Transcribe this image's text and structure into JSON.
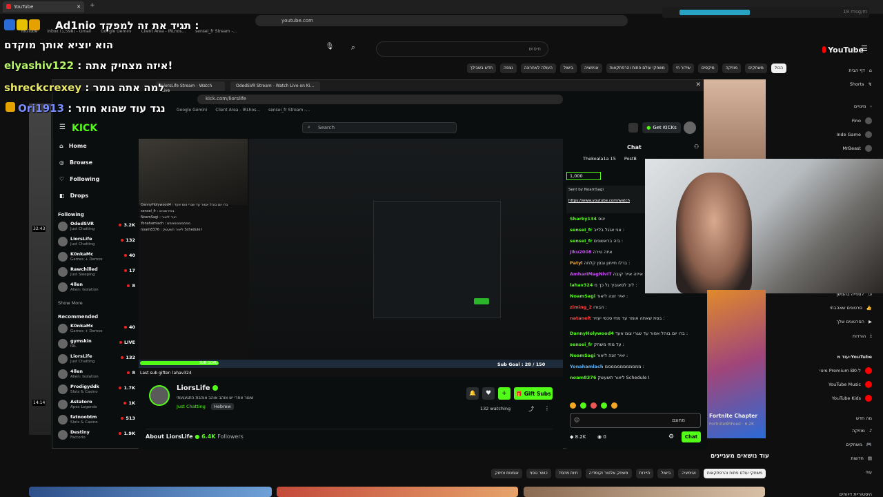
{
  "outer_browser": {
    "tab_title": "YouTube",
    "url": "youtube.com",
    "bookmarks": [
      "YouTube",
      "Inbox (1,598) - Gmail",
      "Google Gemini",
      "Client Area - IRLhos...",
      "sensei_fr Stream -..."
    ],
    "media_label": "18 msg/m"
  },
  "chat_overlay": [
    {
      "user": "Ad1nio",
      "text": "תגיד את זה למפקד :"
    },
    {
      "user": "",
      "text": "הוא יוציא אותך מוקדם"
    },
    {
      "user": "elyashiv122",
      "text": ": איזה מצחיק אתה!"
    },
    {
      "user": "shreckcrexey",
      "text": ": למה אתה גומר"
    },
    {
      "user": "Ori1913",
      "text": ": נגד עוד שהוא חוזר"
    }
  ],
  "youtube": {
    "logo": "YouTube",
    "search_placeholder": "חיפוש",
    "chips": [
      "הכול",
      "משחקים",
      "מוזיקה",
      "מיקסים",
      "שידור חי",
      "משחקי עולם פתוח והרפתקאות",
      "אנימציה",
      "בישול",
      "העולה לאחרונה",
      "נצפה",
      "חדש בשבילך"
    ],
    "sidebar": [
      {
        "label": "דף הבית"
      },
      {
        "label": "Shorts"
      },
      {
        "label": "מינויים"
      },
      {
        "label": "Fino"
      },
      {
        "label": "Inde Game"
      },
      {
        "label": "MrBeast"
      },
      {
        "label": "לצפייה בהמשך"
      },
      {
        "label": "סרטונים שאהבתי"
      },
      {
        "label": "הסרטונים שלך"
      },
      {
        "label": "הורדות"
      },
      {
        "label": "עוד מ-YouTube"
      },
      {
        "label": "מינוי Premium ל-₪0"
      },
      {
        "label": "YouTube Music"
      },
      {
        "label": "YouTube Kids"
      },
      {
        "label": "מה חדש"
      },
      {
        "label": "מוזיקה"
      },
      {
        "label": "משחקים"
      },
      {
        "label": "חדשות"
      },
      {
        "label": "עוד"
      },
      {
        "label": "היסטוריית דיווחים"
      }
    ],
    "video_title": "Fortnite Chapter 6 Season 4 Trailer",
    "video_meta": "FortniteBRFeed · 6.2K",
    "topics_heading": "עוד נושאים מעניינים",
    "bottom_chips": [
      "משחקי עולם פתוח והרפתקאות",
      "אנימציה",
      "בישול",
      "תיירות",
      "משחק אלטור וקומדיה",
      "חיות מחמד",
      "כושר גופני",
      "אומנות וחיזוק"
    ],
    "timestamps": [
      "32:43",
      "14:14"
    ]
  },
  "kick_window": {
    "tabs": [
      "LiorsLife Stream - Watch Live",
      "OdedSVR Stream - Watch Live on Ki..."
    ],
    "url": "kick.com/liorslife",
    "bookmarks": [
      "Google Gemini",
      "Client Area - IRLhos...",
      "sensei_fr Stream -..."
    ],
    "logo": "KICK",
    "search_placeholder": "Search",
    "get_kicks": "Get KICKs",
    "nav": [
      {
        "label": "Home"
      },
      {
        "label": "Browse"
      },
      {
        "label": "Following"
      },
      {
        "label": "Drops"
      }
    ],
    "following_heading": "Following",
    "following": [
      {
        "name": "OdedSVR",
        "category": "Just Chatting",
        "viewers": "3.2K"
      },
      {
        "name": "LiorsLife",
        "category": "Just Chatting",
        "viewers": "132"
      },
      {
        "name": "K0nkaMc",
        "category": "Games + Demos",
        "viewers": "40"
      },
      {
        "name": "Rawchilled",
        "category": "Just Sleeping",
        "viewers": "17"
      },
      {
        "name": "4llen",
        "category": "Alien: Isolation",
        "viewers": "8"
      }
    ],
    "show_more": "Show More",
    "recommended_heading": "Recommended",
    "recommended": [
      {
        "name": "K0nkaMc",
        "category": "Games + Demos",
        "viewers": "40"
      },
      {
        "name": "gymskin",
        "category": "IRL",
        "viewers": "LIVE"
      },
      {
        "name": "LiorsLife",
        "category": "Just Chatting",
        "viewers": "132"
      },
      {
        "name": "4llen",
        "category": "Alien: Isolation",
        "viewers": "8"
      },
      {
        "name": "Prodigyddk",
        "category": "Slots & Casino",
        "viewers": "1.7K"
      },
      {
        "name": "Astatoro",
        "category": "Apex Legends",
        "viewers": "1K"
      },
      {
        "name": "fatnoobtm",
        "category": "Slots & Casino",
        "viewers": "513"
      },
      {
        "name": "Destiny",
        "category": "Factorio",
        "viewers": "1.9K"
      }
    ],
    "stream": {
      "name": "LiorsLife",
      "subtitle": "שיגור אחרי יש אוהב אוהב אוהבת התגעגעתי",
      "category": "Just Chatting",
      "language": "Hebrew",
      "watching": "132 watching",
      "gift_subs": "Gift Subs",
      "about": "About LiorsLife",
      "followers": "6.4K",
      "followers_label": "Followers",
      "last_sub": "Last sub gifter: lahav324",
      "sub_goal": "Sub Goal : 28 / 150",
      "sub_goal_fraction": 0.19,
      "goal_text": "SUB GOAL:"
    },
    "video_chat_lines": [
      "DannyHolywood4 : ברו יום בוהל אמור עד שנרי צומ אעד",
      "sensei_fr : באירשונים",
      "NoamSagi : יאיר ליאור",
      "Yonahamlach : ממממממממממ",
      "noam8376 : ליאור תשעשק Schedule I"
    ],
    "chat": {
      "title": "Chat",
      "pinned_users": [
        "Thekoala1a 15",
        "PostB"
      ],
      "goal_count": "1,000",
      "sent_by": "Sent by NoamSagi",
      "pinned_link": "https://www.youtube.com/watch",
      "messages": [
        {
          "user": "Sharky134",
          "text": "יטס"
        },
        {
          "user": "sensei_fr",
          "text": "אני אנגל בלייב :"
        },
        {
          "user": "sensei_fr",
          "text": "ביה בראשונים :"
        },
        {
          "user": "jiku2008",
          "text": "איזה טירה"
        },
        {
          "user": "Patyl",
          "text": "ברלו חייחון ובסן קלחה :"
        },
        {
          "user": "AmharIMagNivIT",
          "text": "אייזה אייר קובה :"
        },
        {
          "user": "lahav324",
          "text": "ליב לסאוביך גל כך מ :"
        },
        {
          "user": "NoamSagi",
          "text": "יאיר זונה ליאור :"
        },
        {
          "user": "ziming_2",
          "text": "הבורו :"
        },
        {
          "user": "natanelt",
          "text": "בסת שאתה אומר עד מתי סכסי יעזיר :"
        },
        {
          "user": "DannyHolywood4",
          "text": "ברו יום בוהל אמור עד שגרי צומ אעד :"
        },
        {
          "user": "sensei_fr",
          "text": "עד מתי משחק :"
        },
        {
          "user": "NoamSagi",
          "text": "יאיר זונה ליאור :"
        },
        {
          "user": "Yonahamlach",
          "text": "ממממממממממממ :"
        },
        {
          "user": "noam8376",
          "text": "ליאור תשעשק Schedule I"
        }
      ],
      "input_value": "מחוגם",
      "chat_button": "Chat",
      "points": "8.2K",
      "kicks": "0"
    }
  }
}
